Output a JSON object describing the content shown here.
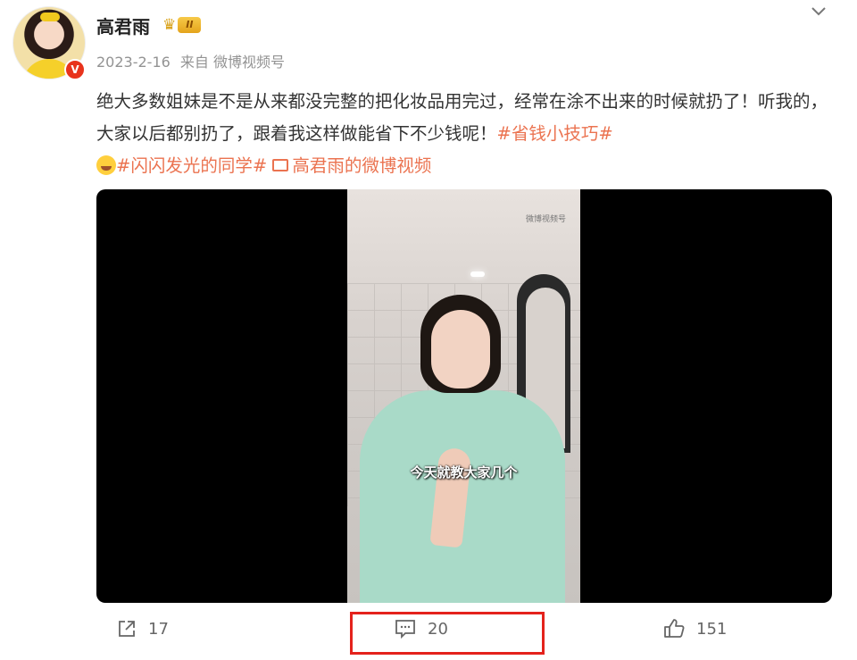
{
  "post": {
    "author": "高君雨",
    "rank_badge": "II",
    "verified_badge": "V",
    "date": "2023-2-16",
    "source": "来自 微博视频号",
    "text_plain": "绝大多数姐妹是不是从来都没完整的把化妆品用完过，经常在涂不出来的时候就扔了！听我的，大家以后都别扔了，跟着我这样做能省下不少钱呢！",
    "topic_1": "#省钱小技巧#",
    "topic_2": "#闪闪发光的同学#",
    "video_link": "高君雨的微博视频",
    "video_subtitle": "今天就教大家几个",
    "video_watermark": "微博视频号"
  },
  "actions": {
    "share_count": "17",
    "comment_count": "20",
    "like_count": "151"
  },
  "colors": {
    "topic": "#eb7350",
    "highlight_box": "#e4221c",
    "verified": "#e8331c"
  }
}
